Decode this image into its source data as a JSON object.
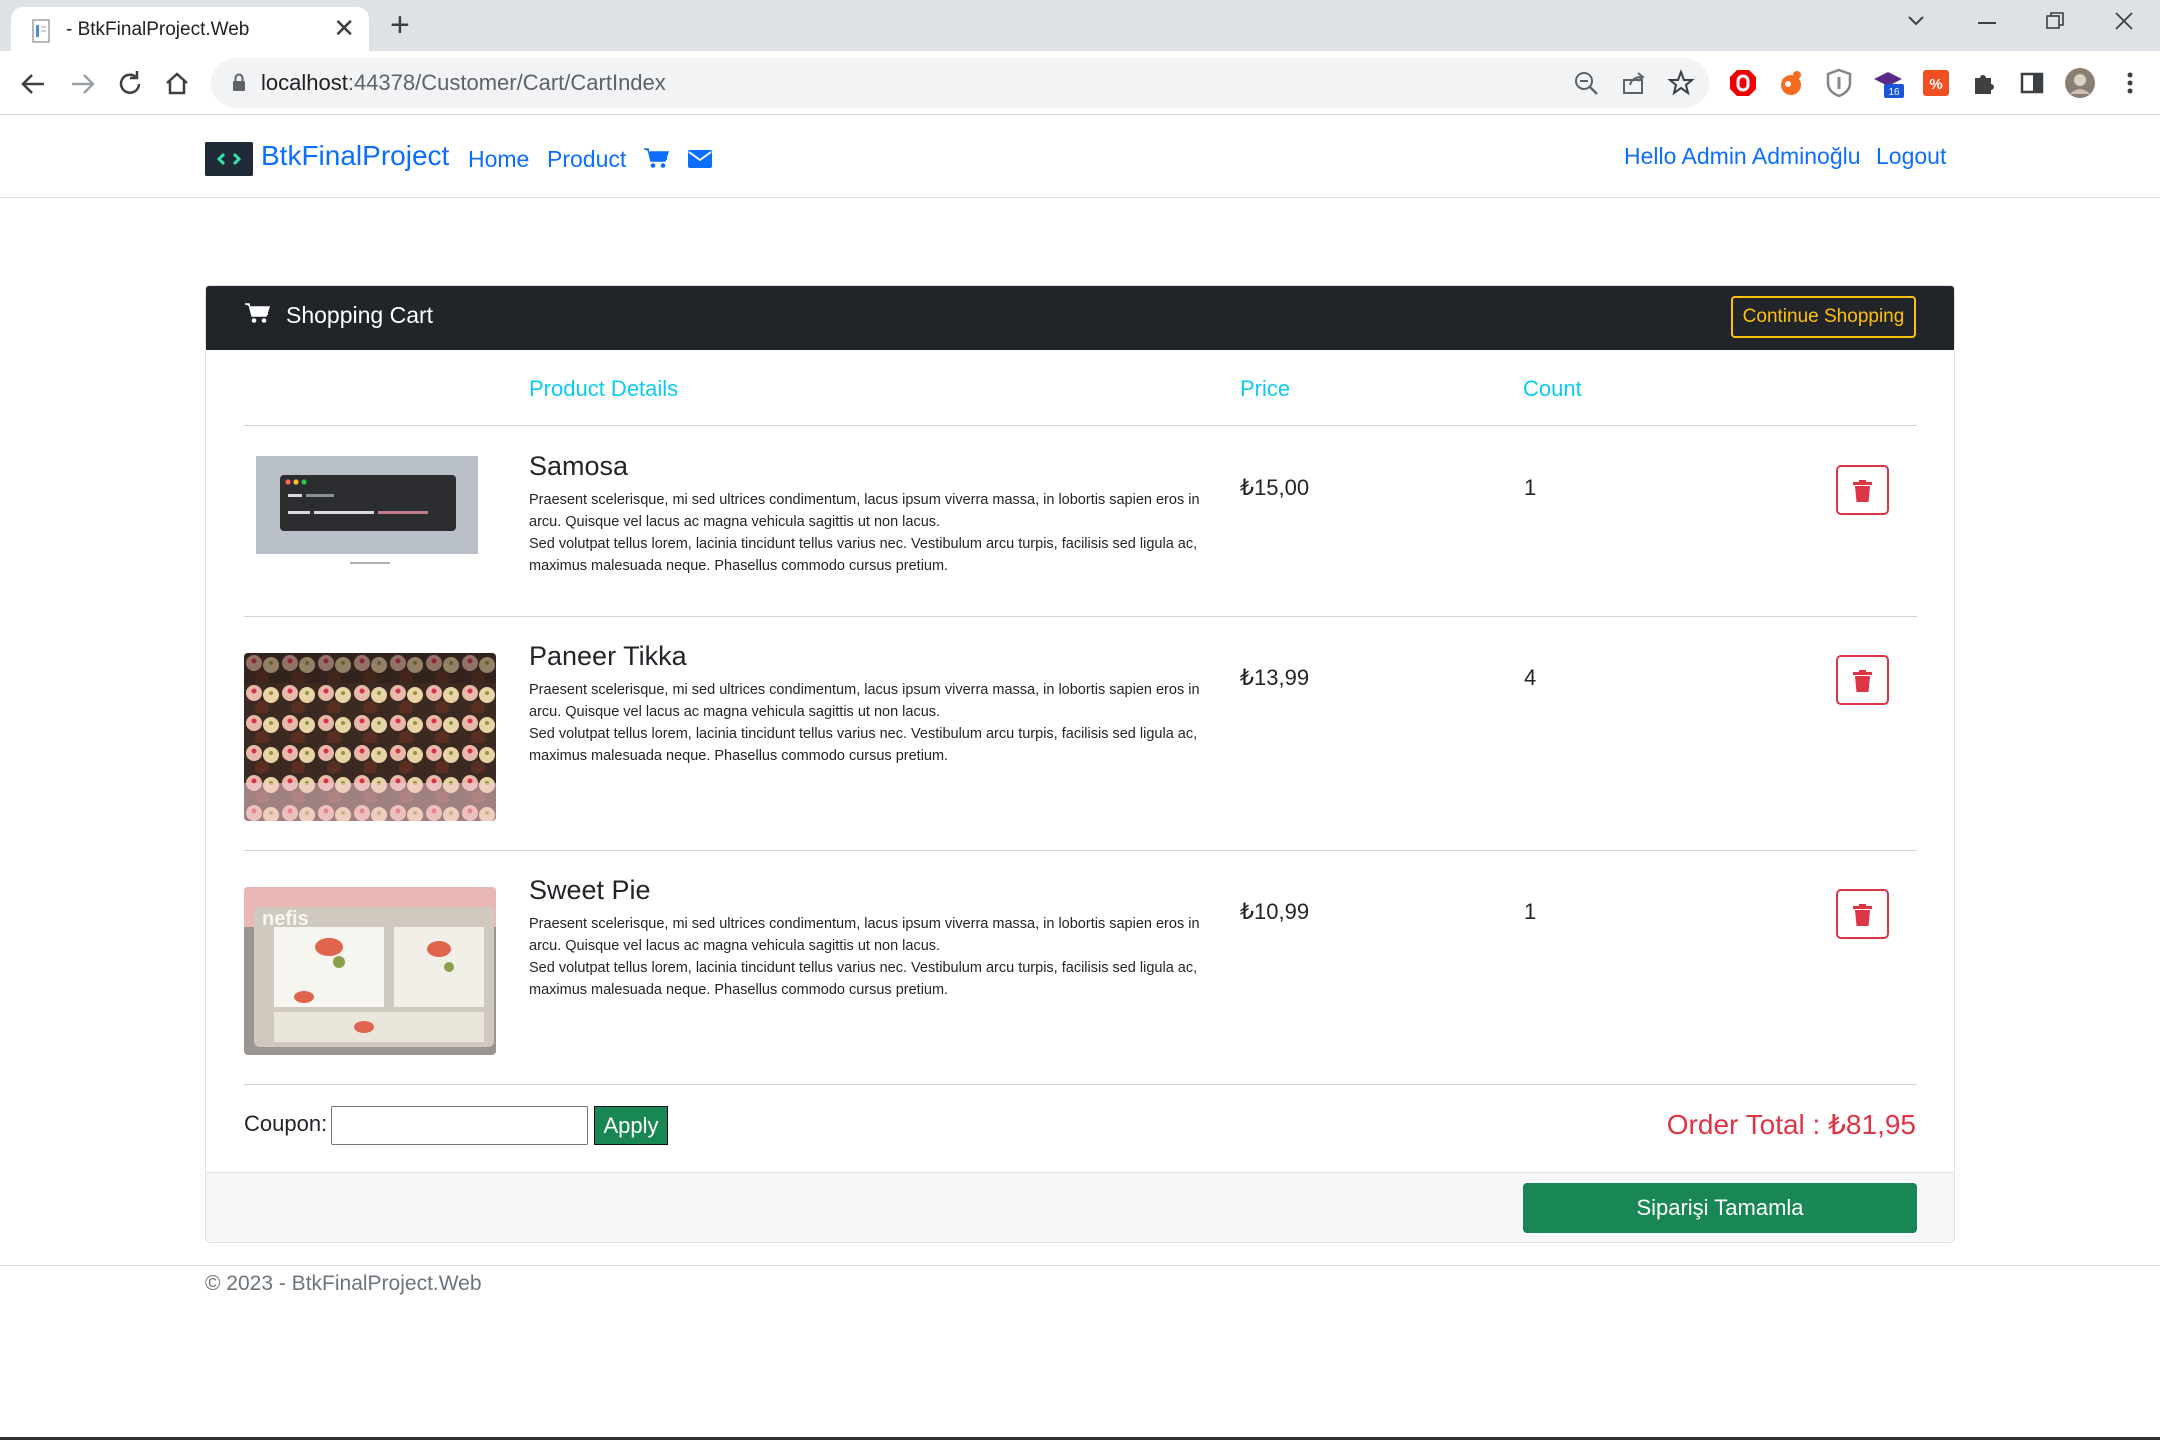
{
  "browser": {
    "tab_title": "- BtkFinalProject.Web",
    "url_host": "localhost",
    "url_rest": ":44378/Customer/Cart/CartIndex",
    "ext_badge": "16"
  },
  "navbar": {
    "brand": "BtkFinalProject",
    "links": [
      "Home",
      "Product"
    ],
    "greeting": "Hello Admin Adminoğlu",
    "logout": "Logout"
  },
  "cart": {
    "title": "Shopping Cart",
    "continue_label": "Continue Shopping",
    "columns": {
      "details": "Product Details",
      "price": "Price",
      "count": "Count"
    },
    "items": [
      {
        "name": "Samosa",
        "desc1": "Praesent scelerisque, mi sed ultrices condimentum, lacus ipsum viverra massa, in lobortis sapien eros in arcu. Quisque vel lacus ac magna vehicula sagittis ut non lacus.",
        "desc2": "Sed volutpat tellus lorem, lacinia tincidunt tellus varius nec. Vestibulum arcu turpis, facilisis sed ligula ac, maximus malesuada neque. Phasellus commodo cursus pretium.",
        "price": "₺15,00",
        "count": "1"
      },
      {
        "name": "Paneer Tikka",
        "desc1": "Praesent scelerisque, mi sed ultrices condimentum, lacus ipsum viverra massa, in lobortis sapien eros in arcu. Quisque vel lacus ac magna vehicula sagittis ut non lacus.",
        "desc2": "Sed volutpat tellus lorem, lacinia tincidunt tellus varius nec. Vestibulum arcu turpis, facilisis sed ligula ac, maximus malesuada neque. Phasellus commodo cursus pretium.",
        "price": "₺13,99",
        "count": "4"
      },
      {
        "name": "Sweet Pie",
        "desc1": "Praesent scelerisque, mi sed ultrices condimentum, lacus ipsum viverra massa, in lobortis sapien eros in arcu. Quisque vel lacus ac magna vehicula sagittis ut non lacus.",
        "desc2": "Sed volutpat tellus lorem, lacinia tincidunt tellus varius nec. Vestibulum arcu turpis, facilisis sed ligula ac, maximus malesuada neque. Phasellus commodo cursus pretium.",
        "price": "₺10,99",
        "count": "1"
      }
    ],
    "coupon_label": "Coupon:",
    "apply_label": "Apply",
    "order_total": "Order Total : ₺81,95",
    "complete_label": "Siparişi Tamamla"
  },
  "footer": {
    "text": "© 2023 - BtkFinalProject.Web"
  },
  "colors": {
    "primary": "#0d6efd",
    "info": "#0dcaf0",
    "warning": "#ffc107",
    "danger": "#dc3545",
    "success": "#198754",
    "dark": "#212529"
  },
  "icons": [
    "page-icon",
    "close-icon",
    "plus-icon",
    "chevron-down-icon",
    "minimize-icon",
    "restore-icon",
    "back-icon",
    "forward-icon",
    "reload-icon",
    "home-icon",
    "lock-icon",
    "zoom-icon",
    "share-icon",
    "star-icon",
    "cart-icon",
    "envelope-icon",
    "trash-icon",
    "puzzle-icon",
    "sidepanel-icon",
    "avatar",
    "kebab-menu-icon"
  ]
}
